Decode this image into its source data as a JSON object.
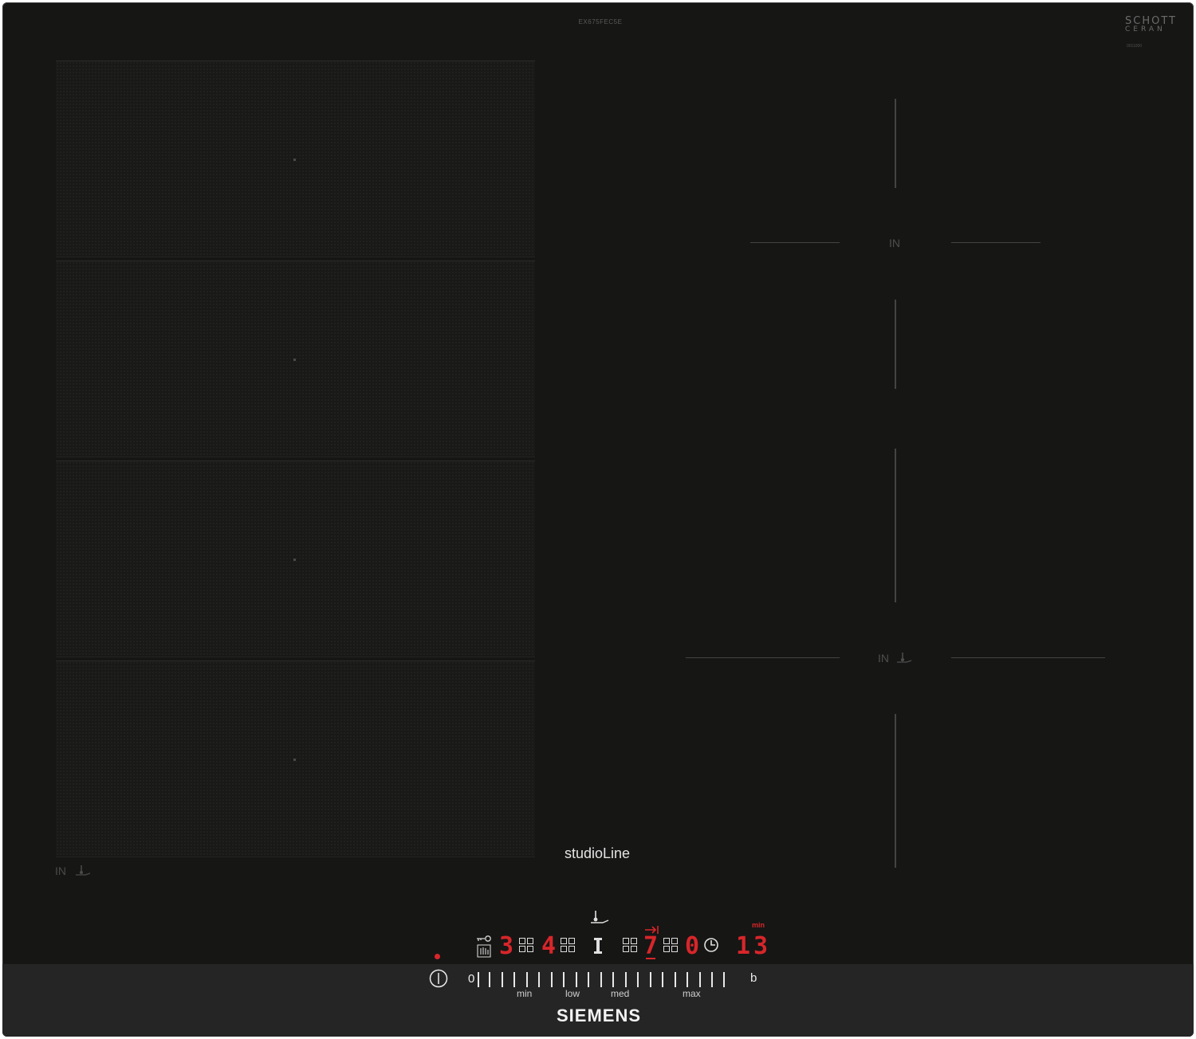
{
  "product": {
    "model_code": "EX675FEC5E",
    "glass_brand_line1": "SCHOTT",
    "glass_brand_line2": "CERAN",
    "glass_code": "0011000",
    "series": "studioLine",
    "brand": "SIEMENS"
  },
  "zones": {
    "flex_label": "IN",
    "upper_right_label": "IN",
    "lower_right_label": "IN"
  },
  "display": {
    "readout_1": "3",
    "readout_2": "4",
    "readout_3": "7",
    "readout_4": "0",
    "timer_value": "13",
    "timer_unit": "min"
  },
  "slider": {
    "zero_label": "0",
    "levels": [
      "min",
      "low",
      "med",
      "max"
    ],
    "boost_label": "b"
  },
  "colors": {
    "glass": "#161615",
    "accent_red": "#d8262a",
    "symbol_white": "#dcdcdc"
  },
  "icons": [
    "lock-icon",
    "wipe-protection-icon",
    "power-icon",
    "timer-icon",
    "frying-sensor-icon",
    "flex-zone-icon",
    "boost-arrow-icon"
  ]
}
